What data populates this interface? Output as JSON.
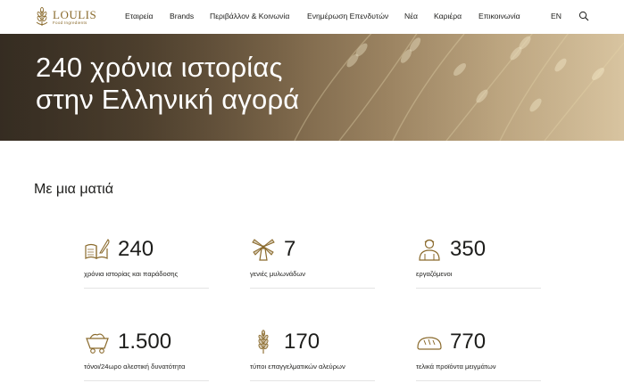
{
  "brand": {
    "name": "LOULIS",
    "tagline": "Food Ingredients",
    "accent_color": "#8a6a2c"
  },
  "nav": {
    "items": [
      {
        "label": "Εταιρεία"
      },
      {
        "label": "Brands"
      },
      {
        "label": "Περιβάλλον & Κοινωνία"
      },
      {
        "label": "Ενημέρωση Επενδυτών"
      },
      {
        "label": "Νέα"
      },
      {
        "label": "Καριέρα"
      },
      {
        "label": "Επικοινωνία"
      }
    ],
    "language": "EN",
    "search_icon": "search-icon"
  },
  "hero": {
    "line1": "240 χρόνια ιστορίας",
    "line2": "στην Ελληνική αγορά"
  },
  "glance": {
    "title": "Με μια ματιά",
    "stats": [
      {
        "value": "240",
        "label": "χρόνια ιστορίας και παράδοσης",
        "icon": "book-quill-icon"
      },
      {
        "value": "7",
        "label": "γενιές μυλωνάδων",
        "icon": "windmill-icon"
      },
      {
        "value": "350",
        "label": "εργαζόμενοι",
        "icon": "worker-icon"
      },
      {
        "value": "1.500",
        "label": "τόνοι/24ωρο αλεστική δυνατότητα",
        "icon": "mine-cart-icon"
      },
      {
        "value": "170",
        "label": "τύποι επαγγελματικών αλεύρων",
        "icon": "wheat-icon"
      },
      {
        "value": "770",
        "label": "τελικά προϊόντα μειγμάτων",
        "icon": "bread-icon"
      }
    ]
  }
}
